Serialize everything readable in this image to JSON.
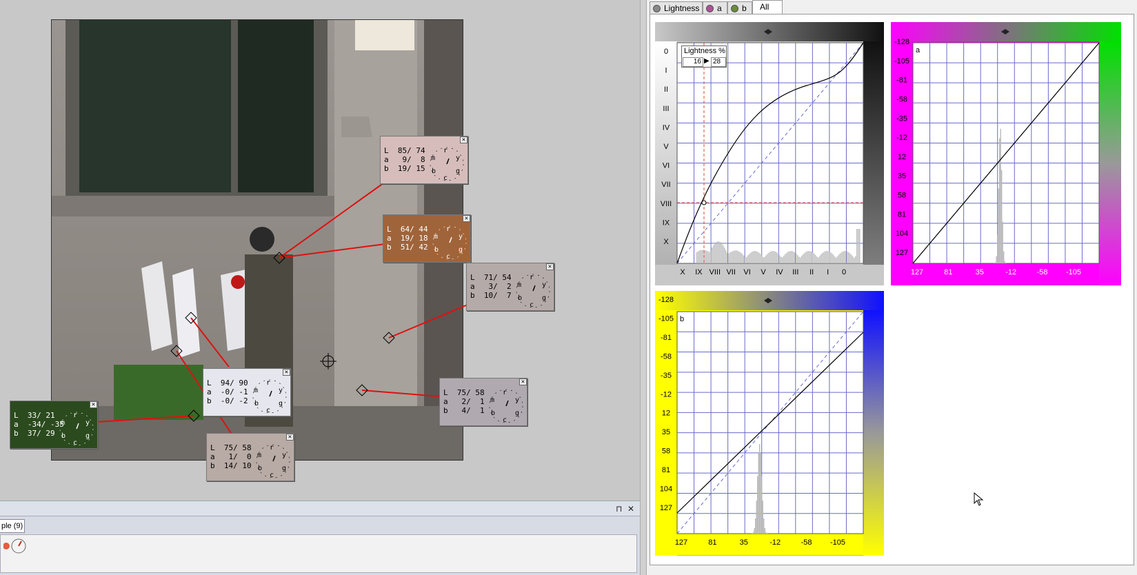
{
  "samplers": [
    {
      "id": "s1",
      "L": "85/ 74",
      "a": " 9/  8",
      "b": "19/ 15",
      "bg": "#d6bdbb",
      "fg": "#000"
    },
    {
      "id": "s2",
      "L": "64/ 44",
      "a": "19/ 18",
      "b": "51/ 42",
      "bg": "#a0643a",
      "fg": "#fff"
    },
    {
      "id": "s3",
      "L": "71/ 54",
      "a": " 3/  2",
      "b": "10/  7",
      "bg": "#b4aaa8",
      "fg": "#000"
    },
    {
      "id": "s4",
      "L": "94/ 90",
      "a": "-0/ -1",
      "b": "-0/ -2",
      "bg": "#e6e6ee",
      "fg": "#000"
    },
    {
      "id": "s5",
      "L": "75/ 58",
      "a": " 2/  1",
      "b": " 4/  1",
      "bg": "#b0aab0",
      "fg": "#000"
    },
    {
      "id": "s6",
      "L": "33/ 21",
      "a": "-34/ -35",
      "b": "37/ 29",
      "bg": "#2b4a1e",
      "fg": "#fff"
    },
    {
      "id": "s7",
      "L": "75/ 58",
      "a": " 1/  0",
      "b": "14/ 10",
      "bg": "#b8aaa4",
      "fg": "#000"
    }
  ],
  "sampler_labels": {
    "L": "L",
    "a": "a",
    "b": "b",
    "close": "✕"
  },
  "dial_letters": {
    "m": "m",
    "r": "r",
    "y": "y",
    "b": "b",
    "c": "c",
    "g": "g"
  },
  "bottom_panel": {
    "tab_label": "ple (9)",
    "pin": "⊓",
    "close": "✕"
  },
  "tabs": [
    {
      "label": "Lightness",
      "ball": "#888"
    },
    {
      "label": "a",
      "ball": "#b0509a"
    },
    {
      "label": "b",
      "ball": "#6a8c3a"
    },
    {
      "label": "All",
      "active": true
    }
  ],
  "lightness": {
    "input_label": "Lightness %",
    "input_from": "16",
    "input_arrow": "▶",
    "input_to": "28",
    "y_labels": [
      "0",
      "I",
      "II",
      "III",
      "IV",
      "V",
      "VI",
      "VII",
      "VIII",
      "IX",
      "X"
    ],
    "x_labels": [
      "X",
      "IX",
      "VIII",
      "VII",
      "VI",
      "V",
      "IV",
      "III",
      "II",
      "I",
      "0"
    ]
  },
  "a_channel": {
    "corner": "a",
    "y_labels": [
      "-128",
      "-105",
      "-81",
      "-58",
      "-35",
      "-12",
      "12",
      "35",
      "58",
      "81",
      "104",
      "127"
    ],
    "x_labels": [
      "127",
      "81",
      "35",
      "-12",
      "-58",
      "-105"
    ]
  },
  "b_channel": {
    "corner": "b",
    "y_labels": [
      "-128",
      "-105",
      "-81",
      "-58",
      "-35",
      "-12",
      "12",
      "35",
      "58",
      "81",
      "104",
      "127"
    ],
    "x_labels": [
      "127",
      "81",
      "35",
      "-12",
      "-58",
      "-105"
    ]
  },
  "colors": {
    "accent_red": "#e01010",
    "grid": "#6a6acc",
    "magenta": "#ff00ff",
    "green": "#00e000",
    "yellow": "#ffff00",
    "blue": "#1010ff"
  }
}
